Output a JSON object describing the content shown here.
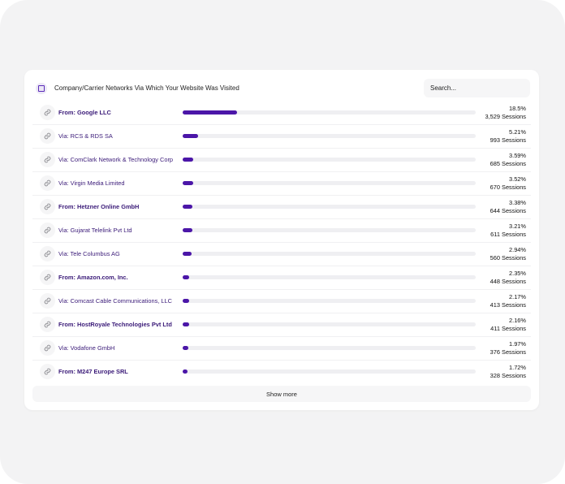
{
  "panel": {
    "title": "Company/Carrier Networks Via Which Your Website Was Visited",
    "icon": "panel-icon",
    "search": {
      "placeholder": "Search...",
      "value": ""
    },
    "show_more_label": "Show more"
  },
  "colors": {
    "accent": "#4b16a8",
    "track": "#efeff2",
    "label": "#3a1a78"
  },
  "rows": [
    {
      "label": "From: Google LLC",
      "bold": true,
      "percent": "18.5%",
      "sessions": "3,529 Sessions",
      "value": 18.5
    },
    {
      "label": "Via: RCS & RDS SA",
      "bold": false,
      "percent": "5.21%",
      "sessions": "993 Sessions",
      "value": 5.21
    },
    {
      "label": "Via: ComClark Network & Technology Corp",
      "bold": false,
      "percent": "3.59%",
      "sessions": "685 Sessions",
      "value": 3.59
    },
    {
      "label": "Via: Virgin Media Limited",
      "bold": false,
      "percent": "3.52%",
      "sessions": "670 Sessions",
      "value": 3.52
    },
    {
      "label": "From: Hetzner Online GmbH",
      "bold": true,
      "percent": "3.38%",
      "sessions": "644 Sessions",
      "value": 3.38
    },
    {
      "label": "Via: Gujarat Telelink Pvt Ltd",
      "bold": false,
      "percent": "3.21%",
      "sessions": "611 Sessions",
      "value": 3.21
    },
    {
      "label": "Via: Tele Columbus AG",
      "bold": false,
      "percent": "2.94%",
      "sessions": "560 Sessions",
      "value": 2.94
    },
    {
      "label": "From: Amazon.com, Inc.",
      "bold": true,
      "percent": "2.35%",
      "sessions": "448 Sessions",
      "value": 2.35
    },
    {
      "label": "Via: Comcast Cable Communications, LLC",
      "bold": false,
      "percent": "2.17%",
      "sessions": "413 Sessions",
      "value": 2.17
    },
    {
      "label": "From: HostRoyale Technologies Pvt Ltd",
      "bold": true,
      "percent": "2.16%",
      "sessions": "411 Sessions",
      "value": 2.16
    },
    {
      "label": "Via: Vodafone GmbH",
      "bold": false,
      "percent": "1.97%",
      "sessions": "376 Sessions",
      "value": 1.97
    },
    {
      "label": "From: M247 Europe SRL",
      "bold": true,
      "percent": "1.72%",
      "sessions": "328 Sessions",
      "value": 1.72
    }
  ],
  "row_icon": "link-icon"
}
